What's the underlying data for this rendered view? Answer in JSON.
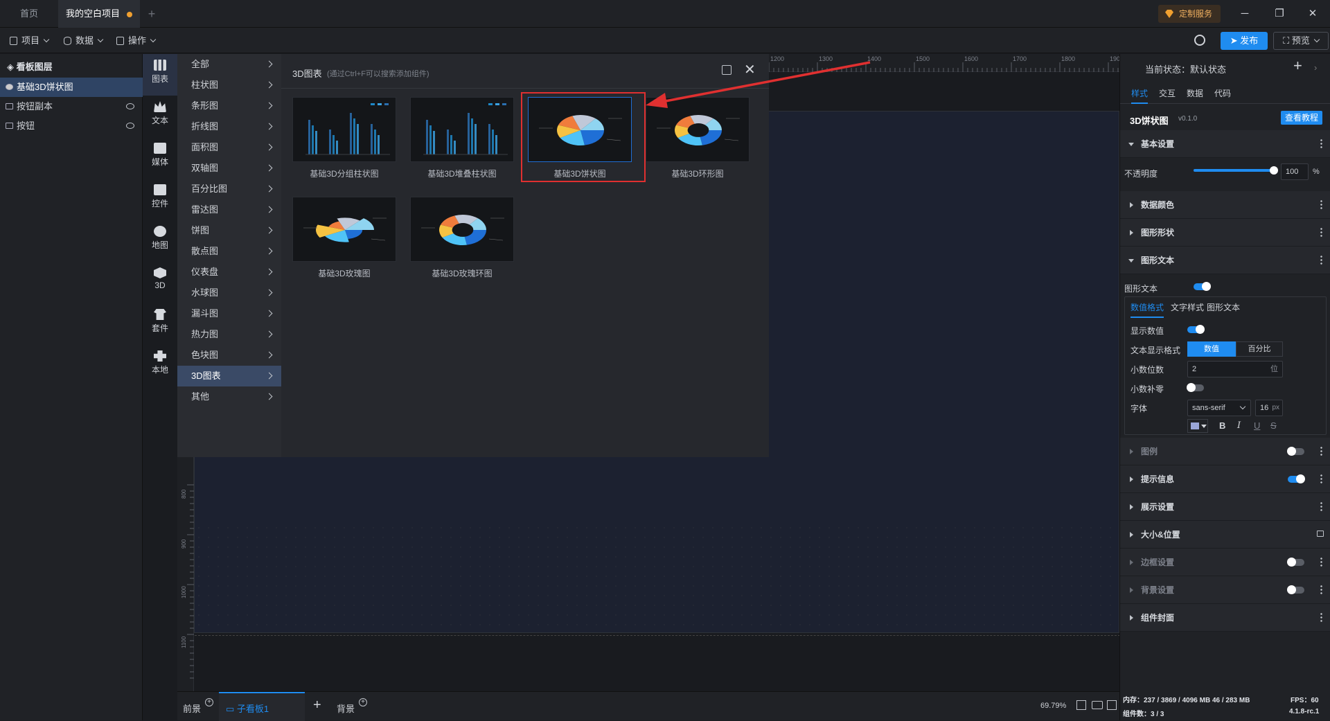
{
  "titlebar": {
    "tabs": [
      {
        "label": "首页",
        "active": false
      },
      {
        "label": "我的空白项目",
        "active": true,
        "unsaved": true
      }
    ],
    "new_tab": "+",
    "custom_service": "定制服务"
  },
  "toolbar": {
    "menus": [
      "项目",
      "数据",
      "操作"
    ],
    "publish": "发布",
    "preview": "预览"
  },
  "layers": {
    "title": "看板图层",
    "items": [
      {
        "label": "基础3D饼状图",
        "selected": true
      },
      {
        "label": "按钮副本",
        "selected": false
      },
      {
        "label": "按钮",
        "selected": false
      }
    ]
  },
  "categories_col": [
    {
      "label": "图表",
      "active": true
    },
    {
      "label": "文本",
      "active": false
    },
    {
      "label": "媒体",
      "active": false
    },
    {
      "label": "控件",
      "active": false
    },
    {
      "label": "地图",
      "active": false
    },
    {
      "label": "3D",
      "active": false
    },
    {
      "label": "套件",
      "active": false
    },
    {
      "label": "本地",
      "active": false
    }
  ],
  "chart_categories": [
    "全部",
    "柱状图",
    "条形图",
    "折线图",
    "面积图",
    "双轴图",
    "百分比图",
    "雷达图",
    "饼图",
    "散点图",
    "仪表盘",
    "水球图",
    "漏斗图",
    "热力图",
    "色块图",
    "3D图表",
    "其他"
  ],
  "active_chart_category": 15,
  "gallery": {
    "title": "3D图表",
    "hint": "(通过Ctrl+F可以搜索添加组件)",
    "items": [
      {
        "label": "基础3D分组柱状图"
      },
      {
        "label": "基础3D堆叠柱状图"
      },
      {
        "label": "基础3D饼状图"
      },
      {
        "label": "基础3D环形图"
      },
      {
        "label": "基础3D玫瑰图"
      },
      {
        "label": "基础3D玫瑰环图"
      }
    ],
    "thumb_numbers": {
      "pie": [
        "60",
        "50",
        "110",
        "75",
        "90"
      ],
      "ring": [
        "60",
        "50",
        "130",
        "55",
        "2510",
        "58"
      ],
      "rose": [
        "55",
        "60",
        "75",
        "90",
        "45"
      ]
    }
  },
  "ruler": {
    "top": [
      "1200",
      "1300",
      "1400",
      "1500",
      "1600",
      "1700",
      "1800",
      "1900"
    ],
    "left": [
      "800",
      "900",
      "1000",
      "1100"
    ]
  },
  "bottombar": {
    "front": "前景",
    "subboard": "子看板1",
    "add": "+",
    "background": "背景",
    "zoom": "69.79%"
  },
  "rightpanel": {
    "state_label": "当前状态：默认状态",
    "tabs": [
      "样式",
      "交互",
      "数据",
      "代码"
    ],
    "component_name": "3D饼状图",
    "version": "v0.1.0",
    "tutorial": "查看教程",
    "basic_settings": "基本设置",
    "opacity_label": "不透明度",
    "opacity_value": "100",
    "opacity_unit": "%",
    "opacity_level": 1.0,
    "data_color": "数据颜色",
    "shape": "图形形状",
    "shape_text": "图形文本",
    "shape_text_toggle_label": "图形文本",
    "subtabs": [
      "数值格式",
      "文字样式",
      "图形文本"
    ],
    "show_value": "显示数值",
    "text_format": "文本显示格式",
    "format_options": [
      "数值",
      "百分比"
    ],
    "decimals_label": "小数位数",
    "decimals_value": "2",
    "decimals_unit": "位",
    "decimal_pad": "小数补零",
    "font_label": "字体",
    "font_value": "sans-serif",
    "font_size": "16",
    "font_size_unit": "px",
    "sections_bottom": [
      {
        "label": "图例",
        "dim": true,
        "toggle": "off"
      },
      {
        "label": "提示信息",
        "dim": false,
        "toggle": "on"
      },
      {
        "label": "展示设置",
        "dim": false,
        "toggle": "none"
      },
      {
        "label": "大小&位置",
        "dim": false,
        "toggle": "lock"
      },
      {
        "label": "边框设置",
        "dim": true,
        "toggle": "off"
      },
      {
        "label": "背景设置",
        "dim": true,
        "toggle": "off"
      },
      {
        "label": "组件封面",
        "dim": false,
        "toggle": "none"
      }
    ],
    "status_memory": "内存：237 / 3869 / 4096 MB  46 / 283 MB",
    "status_fps": "FPS：60",
    "status_count": "组件数：3 / 3",
    "status_version": "4.1.8-rc.1"
  },
  "colors": {
    "accent": "#1f8cf0",
    "highlight": "#e03030",
    "pie": [
      "#1f6fd6",
      "#4fc3f7",
      "#f5c242",
      "#f07c3c",
      "#c0c8d8",
      "#8fd4f0"
    ]
  }
}
